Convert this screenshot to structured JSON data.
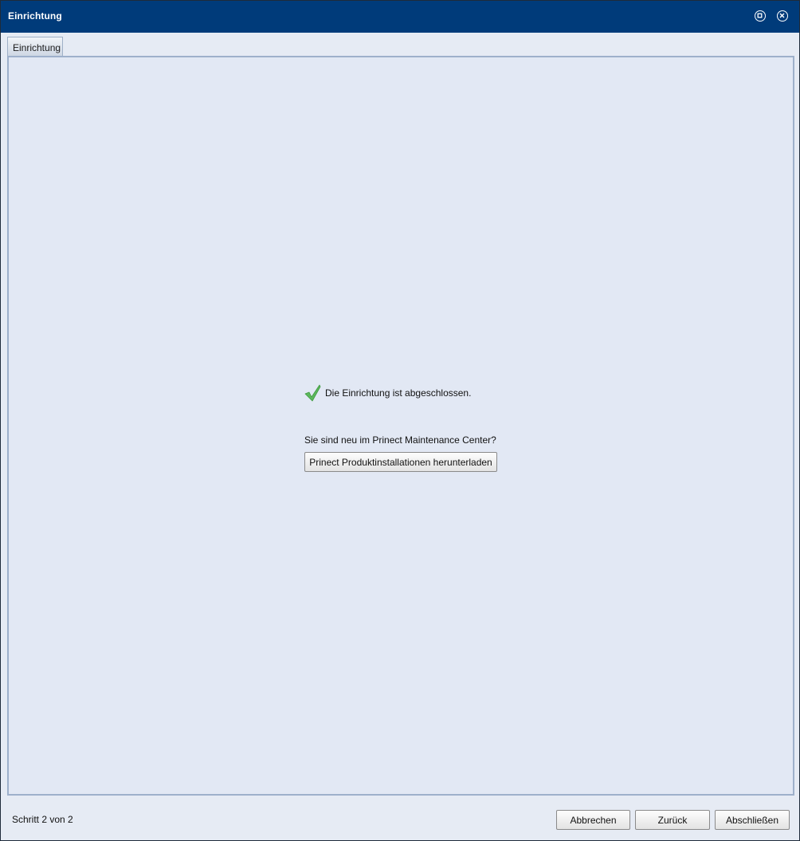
{
  "window": {
    "title": "Einrichtung"
  },
  "titlebar_buttons": {
    "maximize_icon": "maximize-icon",
    "close_icon": "close-icon"
  },
  "tabs": [
    {
      "label": "Einrichtung",
      "selected": true
    }
  ],
  "content": {
    "success_icon": "checkmark-icon",
    "success_message": "Die Einrichtung ist abgeschlossen.",
    "question": "Sie sind neu im Prinect Maintenance Center?",
    "download_button_label": "Prinect Produktinstallationen herunterladen"
  },
  "footer": {
    "step_status": "Schritt 2 von 2",
    "cancel_label": "Abbrechen",
    "back_label": "Zurück",
    "finish_label": "Abschließen"
  },
  "colors": {
    "titlebar": "#003b7a",
    "panel_background": "#e2e8f4",
    "panel_border": "#9eb0cb",
    "checkmark": "#5cb85c"
  }
}
